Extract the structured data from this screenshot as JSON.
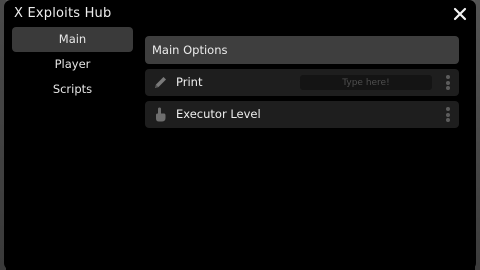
{
  "window": {
    "title": "X Exploits Hub"
  },
  "sidebar": {
    "items": [
      {
        "label": "Main",
        "active": true
      },
      {
        "label": "Player",
        "active": false
      },
      {
        "label": "Scripts",
        "active": false
      }
    ]
  },
  "main": {
    "section_title": "Main Options",
    "options": [
      {
        "label": "Print",
        "icon": "pencil-icon",
        "input_placeholder": "Type here!",
        "input_value": ""
      },
      {
        "label": "Executor Level",
        "icon": "touch-hand-icon"
      }
    ]
  },
  "icons": {
    "close": "close-icon",
    "more": "more-vertical-icon"
  },
  "colors": {
    "window_background": "#000000",
    "active_tab": "#3a3a3a",
    "section_header": "#3e3e3e",
    "option_row": "#1e1e1e",
    "text": "#eeeeee"
  }
}
